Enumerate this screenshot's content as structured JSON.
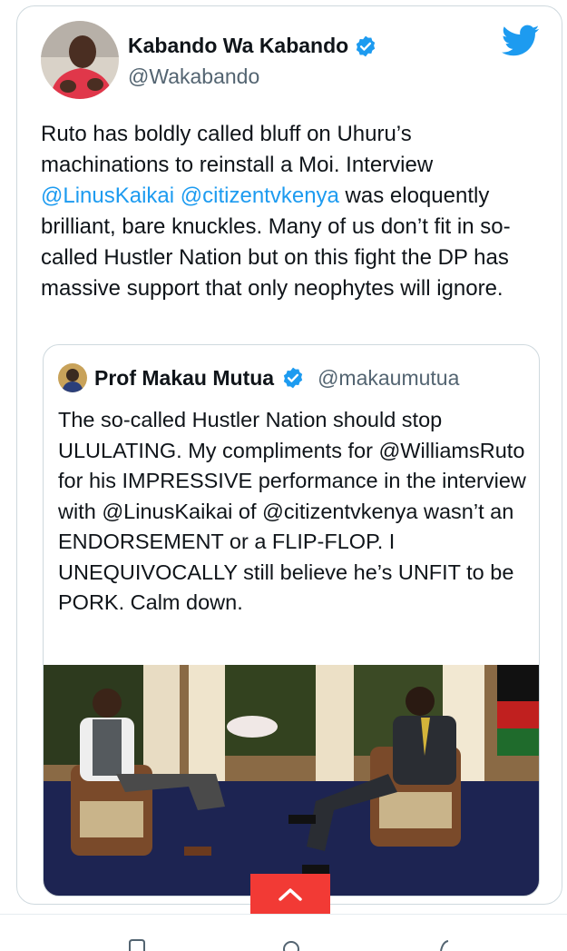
{
  "tweet": {
    "author_name": "Kabando Wa Kabando",
    "handle": "@Wakabando",
    "text_parts": [
      "Ruto has boldly called bluff on Uhuru’s machinations to reinstall a Moi. Interview ",
      "@LinusKaikai",
      " ",
      "@citizentvkenya",
      " was eloquently brilliant, bare knuckles. Many of us don’t fit in so-called Hustler Nation but on this fight the DP has massive support that only neophytes will ignore."
    ]
  },
  "quoted_tweet": {
    "author_name": "Prof Makau Mutua",
    "handle": "@makaumutua",
    "text": "The so-called Hustler Nation should stop ULULATING.  My compliments for @WilliamsRuto for his IMPRESSIVE performance in the interview with @LinusKaikai of @citizentvkenya wasn’t an ENDORSEMENT or a FLIP-FLOP.  I UNEQUIVOCALLY still believe he’s UNFIT to be PORK.  Calm down."
  },
  "icons": {
    "verified": "verified-badge-icon",
    "brand": "twitter-bird-icon",
    "scroll_up": "chevron-up-icon",
    "actions": [
      "reply-icon",
      "retweet-icon",
      "like-icon",
      "share-icon"
    ]
  },
  "colors": {
    "link": "#1d9bf0",
    "verified": "#1d9bf0",
    "up_button": "#f23a35",
    "secondary_text": "#536471"
  }
}
